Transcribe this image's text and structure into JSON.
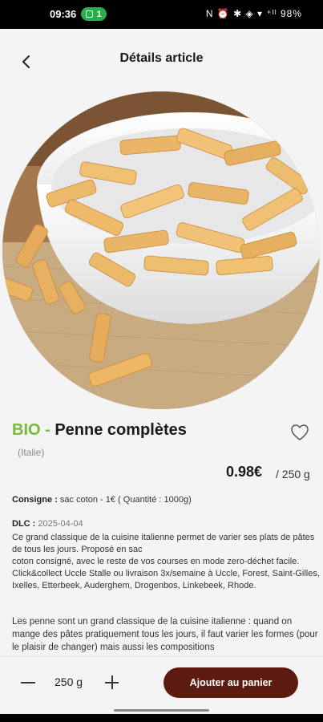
{
  "status_bar": {
    "time": "09:36",
    "notification_count": "1",
    "system_icons": "N ⏰ ✱ ◈ ▾ ⁺ᴵˡ",
    "battery": "98%"
  },
  "header": {
    "title": "Détails article"
  },
  "product": {
    "label": "BIO -",
    "name": "Penne complètes",
    "origin": "(Italie)",
    "price": "0.98€",
    "unit": "/ 250 g",
    "consigne_label": "Consigne :",
    "consigne_value": "sac coton - 1€ ( Quantité : 1000g)",
    "dlc_label": "DLC :",
    "dlc_value": "2025-04-04",
    "description_1": "Ce grand classique de la cuisine italienne permet de varier ses plats de pâtes de tous les jours. Proposé en sac\n coton consigné, avec le reste de vos courses en mode zero-déchet facile. Click&collect Uccle Stalle ou livraison 3x/semaine à Uccle, Forest, Saint-Gilles, Ixelles, Etterbeek, Auderghem, Drogenbos, Linkebeek, Rhode.",
    "description_2": "Les penne sont un grand classique de la cuisine italienne : quand on mange des pâtes pratiquement tous les jours, il faut varier les formes (pour le plaisir de changer) mais aussi les compositions"
  },
  "cart": {
    "quantity": "250 g",
    "add_label": "Ajouter au panier"
  },
  "colors": {
    "bio_green": "#79b83a",
    "cart_button": "#5c1a10",
    "status_pill": "#26b04b"
  }
}
